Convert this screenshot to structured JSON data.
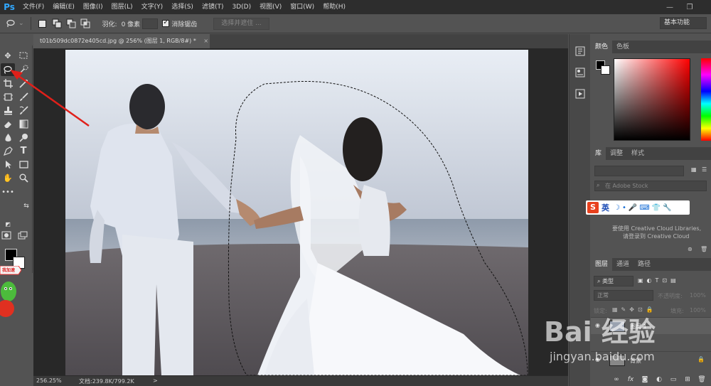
{
  "app": {
    "logo": "Ps"
  },
  "menu": [
    "文件(F)",
    "编辑(E)",
    "图像(I)",
    "图层(L)",
    "文字(Y)",
    "选择(S)",
    "滤镜(T)",
    "3D(D)",
    "视图(V)",
    "窗口(W)",
    "帮助(H)"
  ],
  "window_controls": {
    "minimize": "—",
    "restore": "❐"
  },
  "options": {
    "feather_label": "羽化:",
    "feather_value": "0 像素",
    "antialias_label": "消除锯齿",
    "select_mask_button": "选择并遮住 ...",
    "workspace": "基本功能"
  },
  "document": {
    "tab_title": "t01b509dc0872e405cd.jpg @ 256% (图层 1, RGB/8#) *",
    "close": "×"
  },
  "status": {
    "zoom": "256.25%",
    "doc_info": "文档:239.8K/799.2K",
    "arrow": ">"
  },
  "panels": {
    "color_tabs": [
      "颜色",
      "色板"
    ],
    "library_tabs": [
      "库",
      "调整",
      "样式"
    ],
    "library_search_placeholder": "在 Adobe Stock",
    "library_notice_line1": "要使用 Creative Cloud Libraries,",
    "library_notice_line2": "请登录到 Creative Cloud",
    "ime_label": "英",
    "layers_tabs": [
      "图层",
      "通道",
      "路径"
    ],
    "layer_filter": "类型",
    "blend_mode": "正常",
    "opacity_label": "不透明度:",
    "opacity_value": "100%",
    "lock_label": "锁定:",
    "fill_label": "填充:",
    "fill_value": "100%",
    "layers": [
      {
        "name": "图层 1"
      },
      {
        "name": "背景"
      }
    ]
  },
  "sticker": {
    "text": "我加速"
  },
  "watermark": {
    "text": "Bai 经验",
    "sub": "jingyan.baidu.com"
  },
  "colors": {
    "menubar_bg": "#2d2d2d",
    "panel_bg": "#535353",
    "annotation_arrow": "#e0201a",
    "ps_blue": "#31a8ff"
  }
}
